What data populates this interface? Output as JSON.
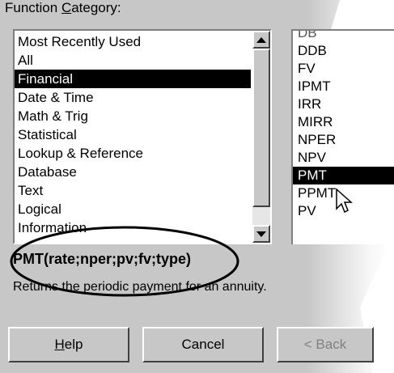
{
  "dialog": {
    "category_label_prefix": "Function ",
    "category_label_hotkey": "C",
    "category_label_suffix": "ategory:"
  },
  "categories": [
    {
      "label": "Most Recently Used"
    },
    {
      "label": "All"
    },
    {
      "label": "Financial"
    },
    {
      "label": "Date & Time"
    },
    {
      "label": "Math & Trig"
    },
    {
      "label": "Statistical"
    },
    {
      "label": "Lookup & Reference"
    },
    {
      "label": "Database"
    },
    {
      "label": "Text"
    },
    {
      "label": "Logical"
    },
    {
      "label": "Information"
    }
  ],
  "selected_category": "Financial",
  "functions": [
    {
      "label": "DB"
    },
    {
      "label": "DDB"
    },
    {
      "label": "FV"
    },
    {
      "label": "IPMT"
    },
    {
      "label": "IRR"
    },
    {
      "label": "MIRR"
    },
    {
      "label": "NPER"
    },
    {
      "label": "NPV"
    },
    {
      "label": "PMT"
    },
    {
      "label": "PPMT"
    },
    {
      "label": "PV"
    }
  ],
  "selected_function": "PMT",
  "syntax": "PMT(rate;nper;pv;fv;type)",
  "description": "Returns the periodic payment for an annuity.",
  "buttons": {
    "help_hotkey": "H",
    "help_rest": "elp",
    "cancel": "Cancel",
    "back": "< Back"
  },
  "icons": [
    "scroll-up-arrow-icon",
    "scroll-down-arrow-icon",
    "mouse-pointer-icon"
  ]
}
